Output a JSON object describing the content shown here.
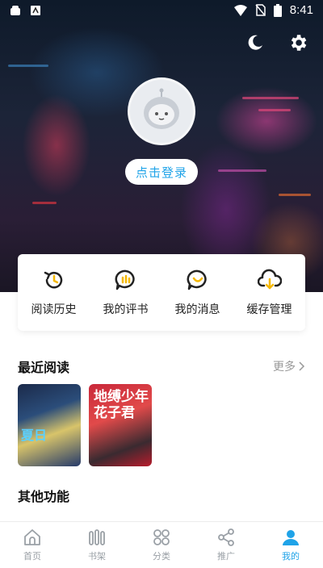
{
  "status_bar": {
    "time": "8:41"
  },
  "profile": {
    "login_label": "点击登录"
  },
  "quick_actions": [
    {
      "label": "阅读历史",
      "icon": "history-icon"
    },
    {
      "label": "我的评书",
      "icon": "comment-icon"
    },
    {
      "label": "我的消息",
      "icon": "message-icon"
    },
    {
      "label": "缓存管理",
      "icon": "download-cloud-icon"
    }
  ],
  "recent": {
    "title": "最近阅读",
    "more_label": "更多",
    "covers": [
      {
        "text": "夏日"
      },
      {
        "text": "地缚少年花子君"
      }
    ]
  },
  "other": {
    "title": "其他功能"
  },
  "nav": [
    {
      "label": "首页",
      "icon": "home-icon"
    },
    {
      "label": "书架",
      "icon": "bookshelf-icon"
    },
    {
      "label": "分类",
      "icon": "category-icon"
    },
    {
      "label": "推广",
      "icon": "share-icon"
    },
    {
      "label": "我的",
      "icon": "user-icon",
      "active": true
    }
  ],
  "colors": {
    "accent": "#1fa3e8",
    "icon_dark": "#222222",
    "icon_gray": "#9aa0a6"
  }
}
